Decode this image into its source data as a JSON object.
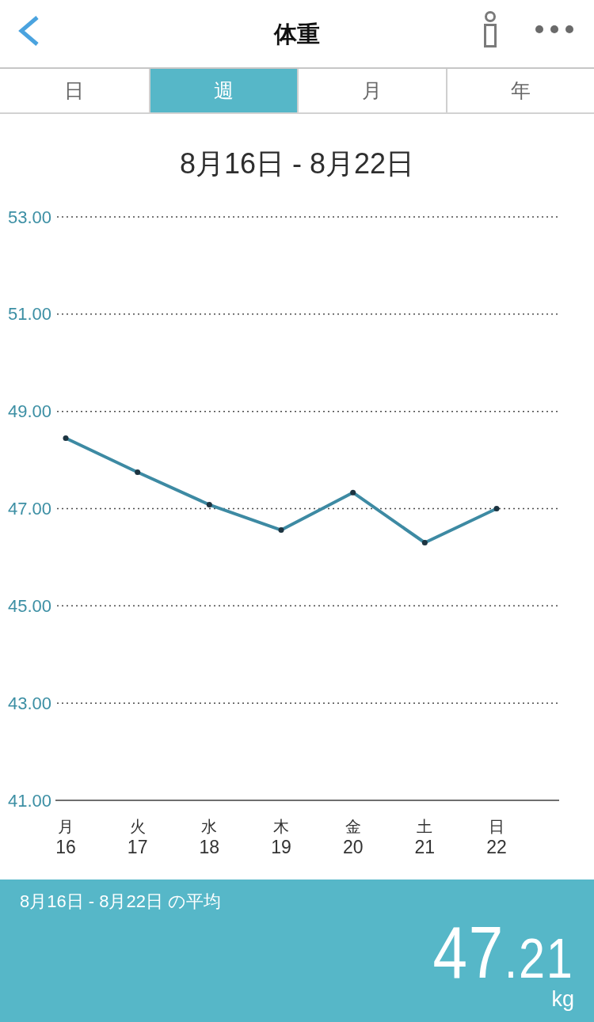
{
  "header": {
    "title": "体重"
  },
  "tabs": [
    {
      "label": "日",
      "selected": false
    },
    {
      "label": "週",
      "selected": true
    },
    {
      "label": "月",
      "selected": false
    },
    {
      "label": "年",
      "selected": false
    }
  ],
  "chart": {
    "period": "8月16日 - 8月22日",
    "weekdays": [
      "月",
      "火",
      "水",
      "木",
      "金",
      "土",
      "日"
    ],
    "chart_data": {
      "type": "line",
      "categories": [
        "16",
        "17",
        "18",
        "19",
        "20",
        "21",
        "22"
      ],
      "values": [
        48.45,
        47.75,
        47.08,
        46.56,
        47.33,
        46.3,
        47.0
      ],
      "ylim": [
        41,
        53
      ],
      "yticks": [
        {
          "value": 53,
          "label": "53.00"
        },
        {
          "value": 51,
          "label": "51.00"
        },
        {
          "value": 49,
          "label": "49.00"
        },
        {
          "value": 47,
          "label": "47.00"
        },
        {
          "value": 45,
          "label": "45.00"
        },
        {
          "value": 43,
          "label": "43.00"
        },
        {
          "value": 41,
          "label": "41.00"
        }
      ],
      "grid": true,
      "marker": true
    }
  },
  "summary": {
    "label": "8月16日 - 8月22日 の平均",
    "value_whole": "47",
    "value_decimal": ".21",
    "unit": "kg"
  }
}
